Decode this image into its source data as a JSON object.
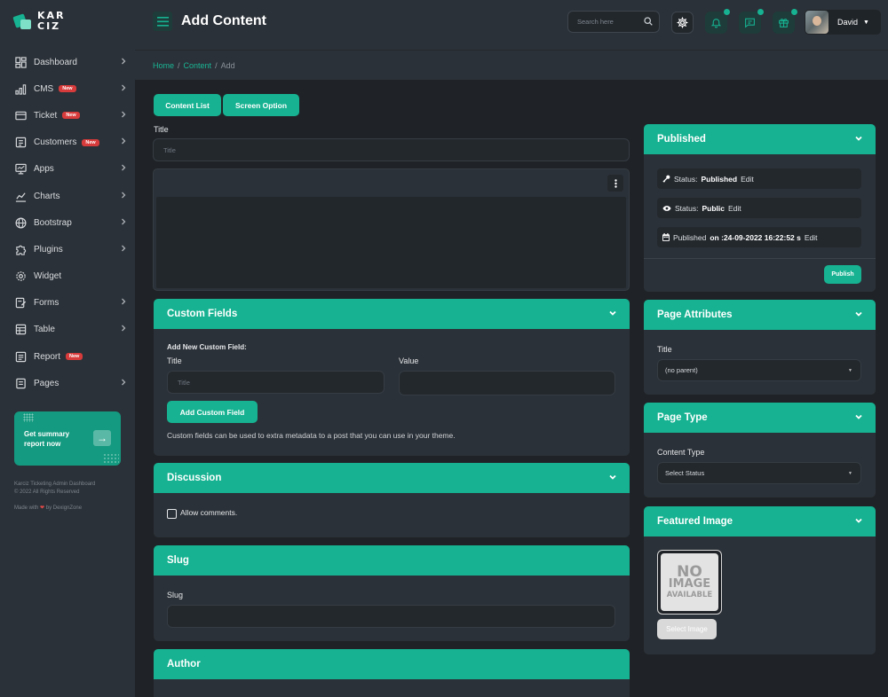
{
  "brand": {
    "name": "KAR CIZ"
  },
  "sidebar": {
    "items": [
      {
        "label": "Dashboard",
        "badge": "",
        "chevron": true,
        "icon": "dashboard-icon"
      },
      {
        "label": "CMS",
        "badge": "New",
        "chevron": true,
        "icon": "bar-chart-icon"
      },
      {
        "label": "Ticket",
        "badge": "New",
        "chevron": true,
        "icon": "ticket-icon"
      },
      {
        "label": "Customers",
        "badge": "New",
        "chevron": true,
        "icon": "customers-icon"
      },
      {
        "label": "Apps",
        "badge": "",
        "chevron": true,
        "icon": "monitor-icon"
      },
      {
        "label": "Charts",
        "badge": "",
        "chevron": true,
        "icon": "chart-icon"
      },
      {
        "label": "Bootstrap",
        "badge": "",
        "chevron": true,
        "icon": "globe-icon"
      },
      {
        "label": "Plugins",
        "badge": "",
        "chevron": true,
        "icon": "puzzle-icon"
      },
      {
        "label": "Widget",
        "badge": "",
        "chevron": false,
        "icon": "widget-gear-icon"
      },
      {
        "label": "Forms",
        "badge": "",
        "chevron": true,
        "icon": "forms-icon"
      },
      {
        "label": "Table",
        "badge": "",
        "chevron": true,
        "icon": "table-icon"
      },
      {
        "label": "Report",
        "badge": "New",
        "chevron": false,
        "icon": "report-icon"
      },
      {
        "label": "Pages",
        "badge": "",
        "chevron": true,
        "icon": "pages-icon"
      }
    ],
    "promo": {
      "text": "Get summary report now",
      "button_icon": "arrow-right-icon"
    },
    "footer": {
      "line1": "Karciz Ticketing Admin Dashboard",
      "line2": "© 2022 All Rights Reserved",
      "made_with_prefix": "Made with",
      "heart": "❤",
      "made_with_suffix": "by DexignZone"
    }
  },
  "header": {
    "title": "Add Content",
    "search_placeholder": "Search here",
    "user_name": "David",
    "accent": "#16b291"
  },
  "breadcrumb": {
    "home": "Home",
    "section": "Content",
    "current": "Add",
    "separator": "/"
  },
  "toolbar": {
    "content_list": "Content List",
    "screen_option": "Screen Option"
  },
  "editor": {
    "title_label": "Title",
    "title_placeholder": "Title",
    "more_icon": "more-vertical-icon"
  },
  "custom_fields": {
    "header": "Custom Fields",
    "add_new_label": "Add New Custom Field:",
    "title_label": "Title",
    "title_placeholder": "Title",
    "value_label": "Value",
    "add_button": "Add Custom Field",
    "help_text": "Custom fields can be used to extra metadata to a post that you can use in your theme."
  },
  "discussion": {
    "header": "Discussion",
    "allow_comments": "Allow comments."
  },
  "slug": {
    "header": "Slug",
    "label": "Slug"
  },
  "author": {
    "header": "Author"
  },
  "published": {
    "header": "Published",
    "status_label": "Status:",
    "status_value": "Published",
    "visibility_label": "Status:",
    "visibility_value": "Public",
    "published_label": "Published",
    "published_value": "on :24-09-2022 16:22:52 s",
    "edit": "Edit",
    "publish_button": "Publish"
  },
  "page_attributes": {
    "header": "Page Attributes",
    "title_label": "Title",
    "parent_value": "(no parent)"
  },
  "page_type": {
    "header": "Page Type",
    "content_type_label": "Content Type",
    "select_value": "Select Status"
  },
  "featured_image": {
    "header": "Featured Image",
    "placeholder_line1": "NO",
    "placeholder_line2": "IMAGE",
    "placeholder_line3": "AVAILABLE",
    "select_button": "Select Image"
  }
}
